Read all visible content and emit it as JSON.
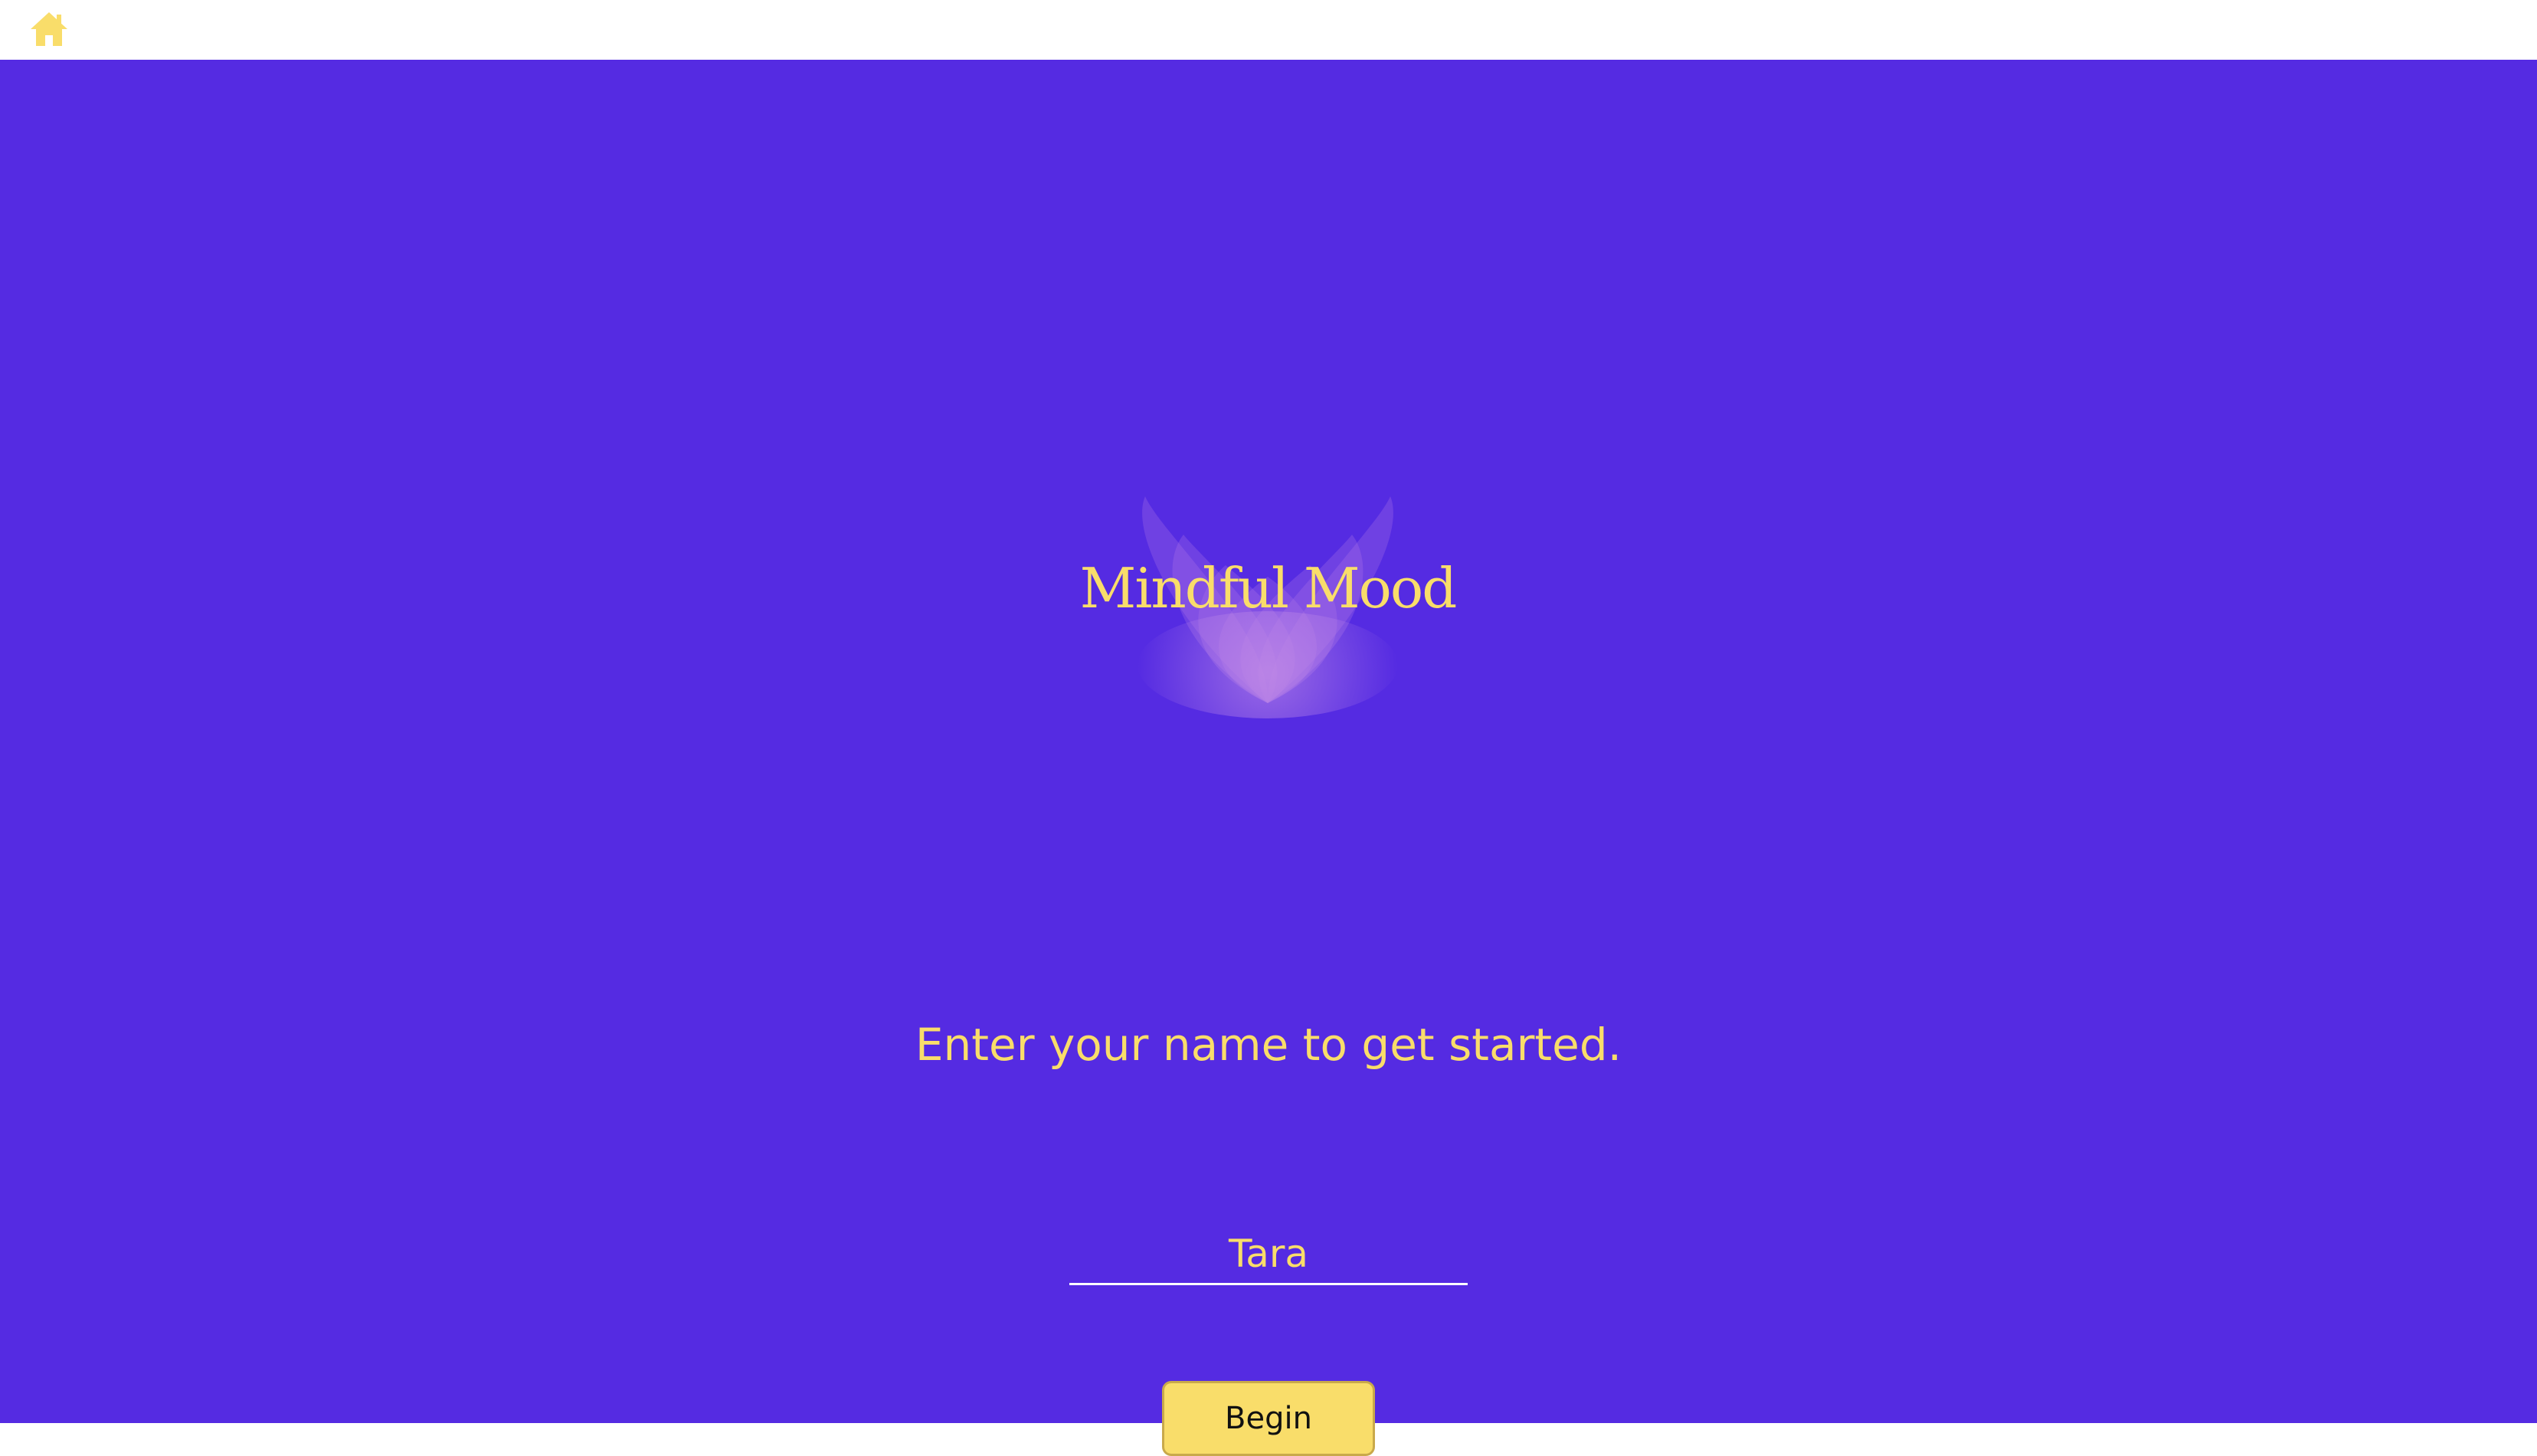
{
  "topbar": {
    "home_icon": "home-icon"
  },
  "logo": {
    "text": "Mindful Mood",
    "icon": "lotus-icon"
  },
  "prompt": {
    "text": "Enter your name to get started."
  },
  "name_field": {
    "value": "Tara"
  },
  "begin_button": {
    "label": "Begin"
  },
  "colors": {
    "background": "#552be2",
    "accent": "#f9dd6a",
    "topbar": "#ffffff",
    "petal": "#b57be6"
  }
}
